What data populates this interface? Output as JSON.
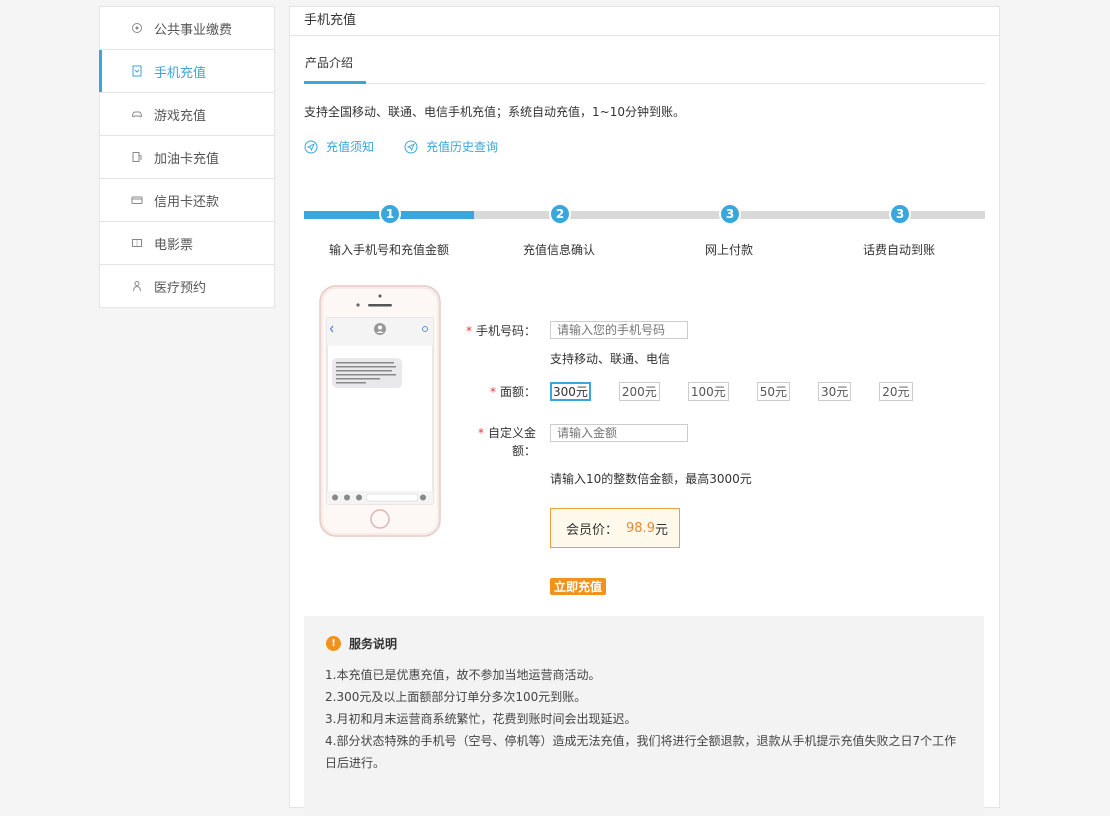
{
  "sidebar": {
    "items": [
      {
        "label": "公共事业缴费",
        "icon": "utility-icon"
      },
      {
        "label": "手机充值",
        "icon": "phone-recharge-icon"
      },
      {
        "label": "游戏充值",
        "icon": "gamepad-icon"
      },
      {
        "label": "加油卡充值",
        "icon": "fuel-card-icon"
      },
      {
        "label": "信用卡还款",
        "icon": "credit-card-icon"
      },
      {
        "label": "电影票",
        "icon": "ticket-icon"
      },
      {
        "label": "医疗预约",
        "icon": "medical-icon"
      }
    ],
    "active_index": 1
  },
  "main": {
    "title": "手机充值",
    "tab": "产品介绍",
    "intro": "支持全国移动、联通、电信手机充值；系统自动充值，1~10分钟到账。",
    "links": [
      "充值须知",
      "充值历史查询"
    ]
  },
  "steps": [
    {
      "num": "1",
      "label": "输入手机号和充值金额"
    },
    {
      "num": "2",
      "label": "充值信息确认"
    },
    {
      "num": "3",
      "label": "网上付款"
    },
    {
      "num": "3",
      "label": "话费自动到账"
    }
  ],
  "form": {
    "phone_label": "手机号码：",
    "phone_placeholder": "请输入您的手机号码",
    "phone_hint": "支持移动、联通、电信",
    "denom_label": "面额：",
    "denominations": [
      "300元",
      "200元",
      "100元",
      "50元",
      "30元",
      "20元"
    ],
    "selected_denom": "300元",
    "custom_label_line1": "自定义金",
    "custom_label_line2": "额：",
    "custom_placeholder": "请输入金额",
    "custom_hint": "请输入10的整数倍金额，最高3000元",
    "price_label": "会员价：",
    "price_value": "98.9",
    "price_unit": "元",
    "submit_label": "立即充值"
  },
  "notice": {
    "title": "服务说明",
    "lines": [
      "1.本充值已是优惠充值，故不参加当地运营商活动。",
      "2.300元及以上面额部分订单分多次100元到账。",
      "3.月初和月末运营商系统繁忙，花费到账时间会出现延迟。",
      "4.部分状态特殊的手机号（空号、停机等）造成无法充值，我们将进行全额退款，退款从手机提示充值失败之日7个工作",
      "日后进行。"
    ]
  },
  "colors": {
    "accent": "#3aa6de",
    "orange": "#f0921c",
    "price": "#e8892e",
    "required": "#e4393c"
  }
}
